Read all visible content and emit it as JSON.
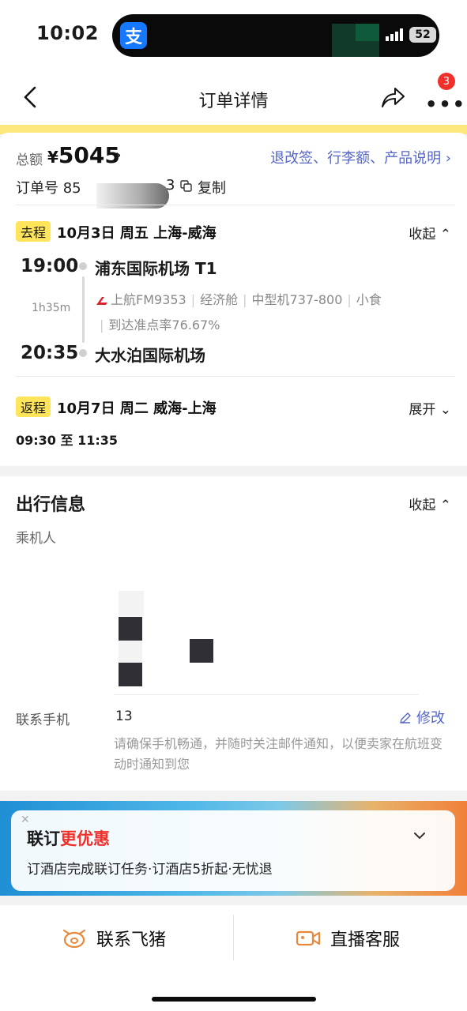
{
  "status_bar": {
    "time": "10:02",
    "app_icon_text": "支",
    "battery": "52"
  },
  "nav": {
    "title": "订单详情",
    "badge_count": "3"
  },
  "order": {
    "total_label": "总额",
    "currency": "¥",
    "total_amount": "5045",
    "policy_links": "退改签、行李额、产品说明",
    "order_no_label": "订单号",
    "order_no_visible_prefix": "85",
    "order_no_visible_suffix": "3",
    "copy_label": "复制"
  },
  "outbound": {
    "tag": "去程",
    "date_route": "10月3日  周五  上海-威海",
    "toggle": "收起",
    "dep_time": "19:00",
    "dep_airport": "浦东国际机场 T1",
    "duration": "1h35m",
    "airline_flight": "上航FM9353",
    "cabin": "经济舱",
    "aircraft": "中型机737-800",
    "meal": "小食",
    "ontime": "到达准点率76.67%",
    "arr_time": "20:35",
    "arr_airport": "大水泊国际机场"
  },
  "return": {
    "tag": "返程",
    "date_route": "10月7日  周二  威海-上海",
    "toggle": "展开",
    "times": "09:30 至 11:35"
  },
  "travel_info": {
    "title": "出行信息",
    "toggle": "收起",
    "passenger_label": "乘机人",
    "contact_label": "联系手机",
    "phone_visible": "13",
    "edit_label": "修改",
    "note": "请确保手机畅通，并随时关注邮件通知，以便卖家在航班变动时通知到您"
  },
  "promo": {
    "title_prefix": "联订",
    "title_highlight": "更优惠",
    "subtitle": "订酒店完成联订任务·订酒店5折起·无忧退"
  },
  "bottom": {
    "contact_fliggy": "联系飞猪",
    "live_service": "直播客服"
  },
  "colors": {
    "accent_blue": "#5566c8",
    "tag_yellow": "#ffe45c",
    "badge_red": "#f0302a",
    "top_strip": "#fbe77b"
  }
}
